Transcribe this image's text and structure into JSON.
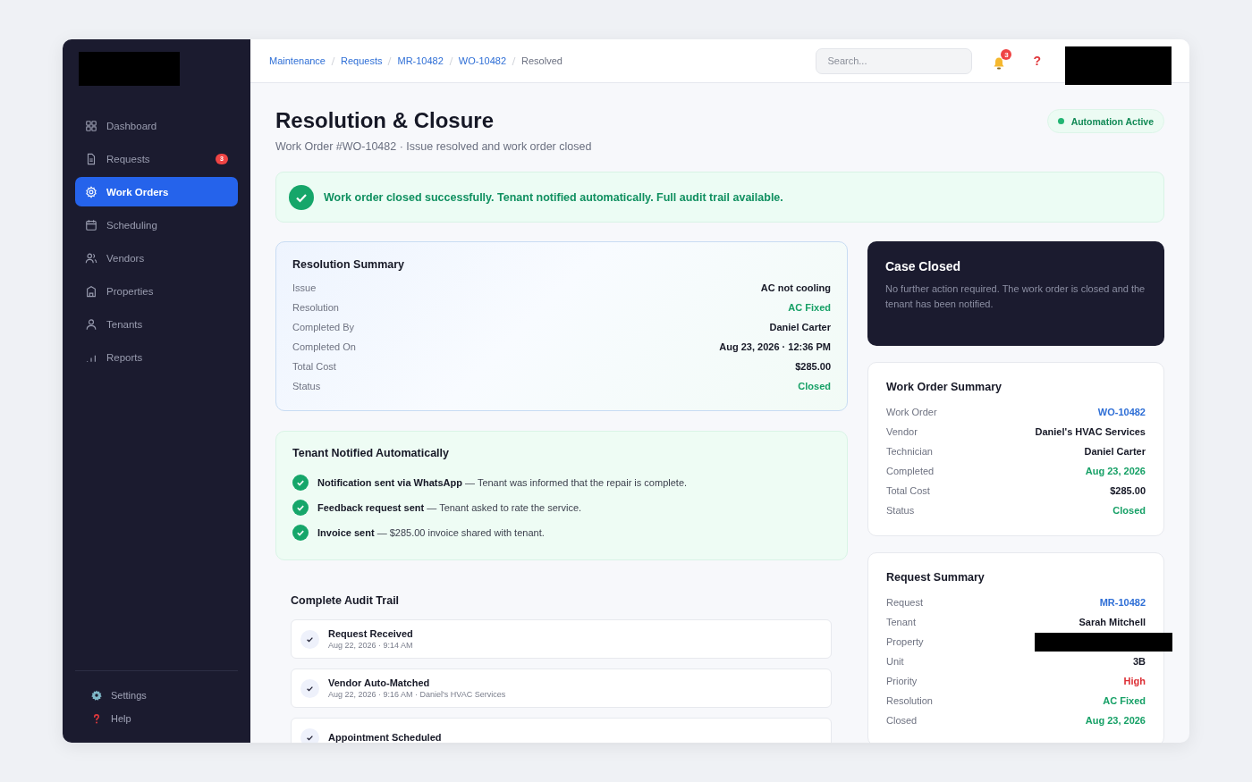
{
  "sidebar": {
    "items": [
      {
        "label": "Dashboard",
        "selected": false
      },
      {
        "label": "Requests",
        "selected": false,
        "badge": "3"
      },
      {
        "label": "Work Orders",
        "selected": true
      },
      {
        "label": "Scheduling",
        "selected": false
      },
      {
        "label": "Vendors",
        "selected": false
      },
      {
        "label": "Properties",
        "selected": false
      },
      {
        "label": "Tenants",
        "selected": false
      },
      {
        "label": "Reports",
        "selected": false
      }
    ],
    "footer_items": [
      {
        "label": "Settings"
      },
      {
        "label": "Help"
      }
    ]
  },
  "topbar": {
    "breadcrumbs": [
      {
        "label": "Maintenance",
        "link": true
      },
      {
        "label": "Requests",
        "link": true
      },
      {
        "label": "MR-10482",
        "link": true
      },
      {
        "label": "WO-10482",
        "link": true
      },
      {
        "label": "Resolved",
        "link": false
      }
    ],
    "search": {
      "placeholder": "Search..."
    },
    "notification_count": "3",
    "help_glyph": "?"
  },
  "header": {
    "title": "Resolution & Closure",
    "subtitle": "Work Order #WO-10482 · Issue resolved and work order closed",
    "status_pill": "Automation Active"
  },
  "banner": "Work order closed successfully. Tenant notified automatically. Full audit trail available.",
  "resolution_summary": {
    "title": "Resolution Summary",
    "rows": [
      {
        "label": "Issue",
        "value": "AC not cooling",
        "kind": "plain"
      },
      {
        "label": "Resolution",
        "value": "AC Fixed",
        "kind": "success"
      },
      {
        "label": "Completed By",
        "value": "Daniel Carter",
        "kind": "plain"
      },
      {
        "label": "Completed On",
        "value": "Aug 23, 2026 · 12:36 PM",
        "kind": "plain"
      },
      {
        "label": "Total Cost",
        "value": "$285.00",
        "kind": "plain"
      },
      {
        "label": "Status",
        "value": "Closed",
        "kind": "success"
      }
    ]
  },
  "tenant_notified": {
    "title": "Tenant Notified Automatically",
    "items": [
      "**Notification sent via WhatsApp** — Tenant was informed that the repair is complete.",
      "**Feedback request sent** — Tenant asked to rate the service.",
      "**Invoice sent** — $285.00 invoice shared with tenant."
    ]
  },
  "audit_trail": {
    "title": "Complete Audit Trail",
    "events": [
      {
        "title": "Request Received",
        "meta": "Aug 22, 2026 · 9:14 AM"
      },
      {
        "title": "Vendor Auto-Matched",
        "meta": "Aug 22, 2026 · 9:16 AM · Daniel's HVAC Services"
      },
      {
        "title": "Appointment Scheduled"
      }
    ]
  },
  "case_closed": {
    "title": "Case Closed",
    "text": "No further action required. The work order is closed and the tenant has been notified."
  },
  "work_order_summary": {
    "title": "Work Order Summary",
    "rows": [
      {
        "label": "Work Order",
        "value": "WO-10482",
        "kind": "link"
      },
      {
        "label": "Vendor",
        "value": "Daniel's HVAC Services",
        "kind": "plain"
      },
      {
        "label": "Technician",
        "value": "Daniel Carter",
        "kind": "plain"
      },
      {
        "label": "Completed",
        "value": "Aug 23, 2026",
        "kind": "success"
      },
      {
        "label": "Total Cost",
        "value": "$285.00",
        "kind": "plain"
      },
      {
        "label": "Status",
        "value": "Closed",
        "kind": "success"
      }
    ]
  },
  "request_summary": {
    "title": "Request Summary",
    "rows": [
      {
        "label": "Request",
        "value": "MR-10482",
        "kind": "link"
      },
      {
        "label": "Tenant",
        "value": "Sarah Mitchell",
        "kind": "plain"
      },
      {
        "label": "Property",
        "kind": "redacted"
      },
      {
        "label": "Unit",
        "value": "3B",
        "kind": "plain"
      },
      {
        "label": "Priority",
        "value": "High",
        "kind": "danger"
      },
      {
        "label": "Resolution",
        "value": "AC Fixed",
        "kind": "success"
      },
      {
        "label": "Closed",
        "value": "Aug 23, 2026",
        "kind": "success"
      }
    ]
  }
}
